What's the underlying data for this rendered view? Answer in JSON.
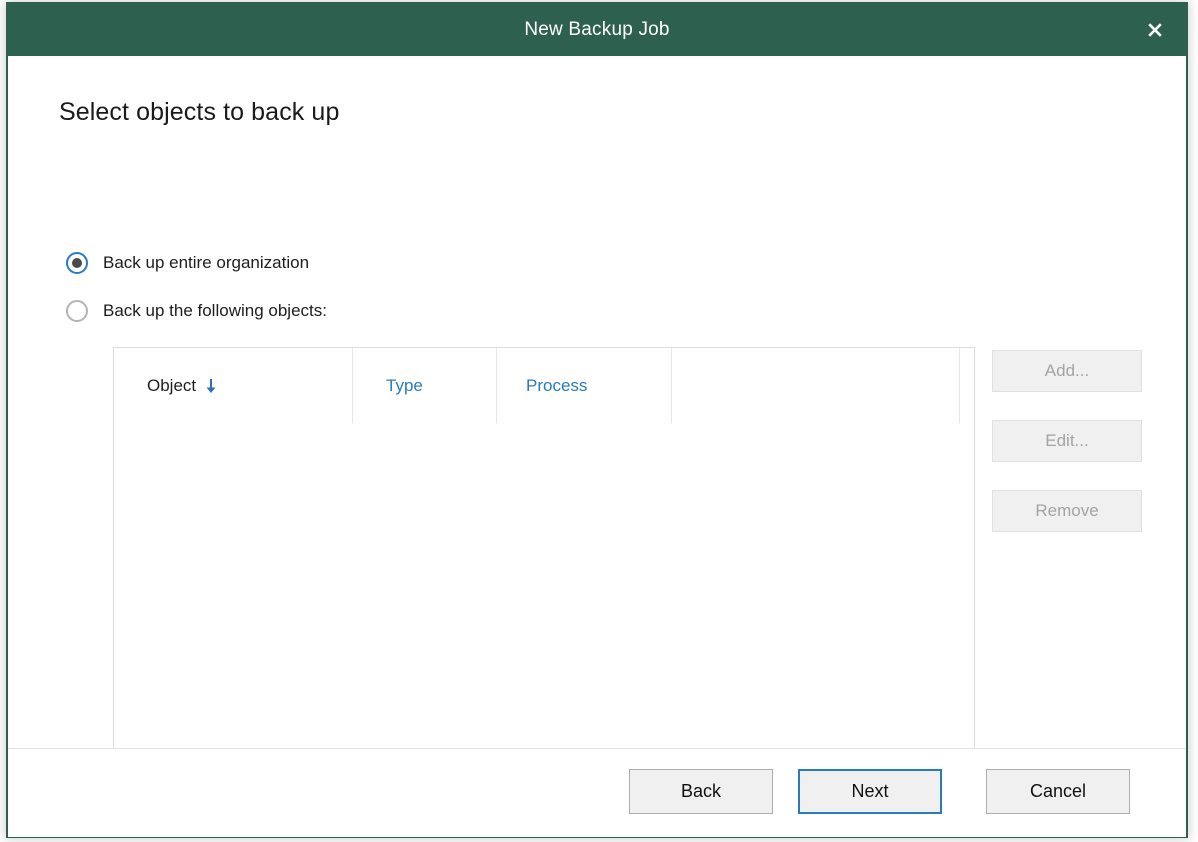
{
  "window": {
    "title": "New Backup Job",
    "close_icon": "close-x-icon",
    "titlebar_color": "#2e6050",
    "border_color": "#2e6050"
  },
  "page": {
    "heading": "Select objects to back up"
  },
  "scope_options": [
    {
      "id": "entire-organization",
      "label": "Back up entire organization",
      "selected": true
    },
    {
      "id": "following-objects",
      "label": "Back up the following objects:",
      "selected": false
    }
  ],
  "objects_table": {
    "columns": [
      {
        "label": "Object",
        "sorted": true,
        "sort_icon": "arrow-down-icon",
        "sort_direction": "descending"
      },
      {
        "label": "Type",
        "sorted": false
      },
      {
        "label": "Process",
        "sorted": false
      }
    ],
    "rows": [],
    "empty": true,
    "header_link_color": "#2a7ac0"
  },
  "side_buttons": [
    {
      "id": "add",
      "label": "Add...",
      "enabled": false
    },
    {
      "id": "edit",
      "label": "Edit...",
      "enabled": false
    },
    {
      "id": "remove",
      "label": "Remove",
      "enabled": false
    }
  ],
  "footer_buttons": [
    {
      "id": "back",
      "label": "Back",
      "default": false
    },
    {
      "id": "next",
      "label": "Next",
      "default": true
    },
    {
      "id": "cancel",
      "label": "Cancel",
      "default": false
    }
  ]
}
